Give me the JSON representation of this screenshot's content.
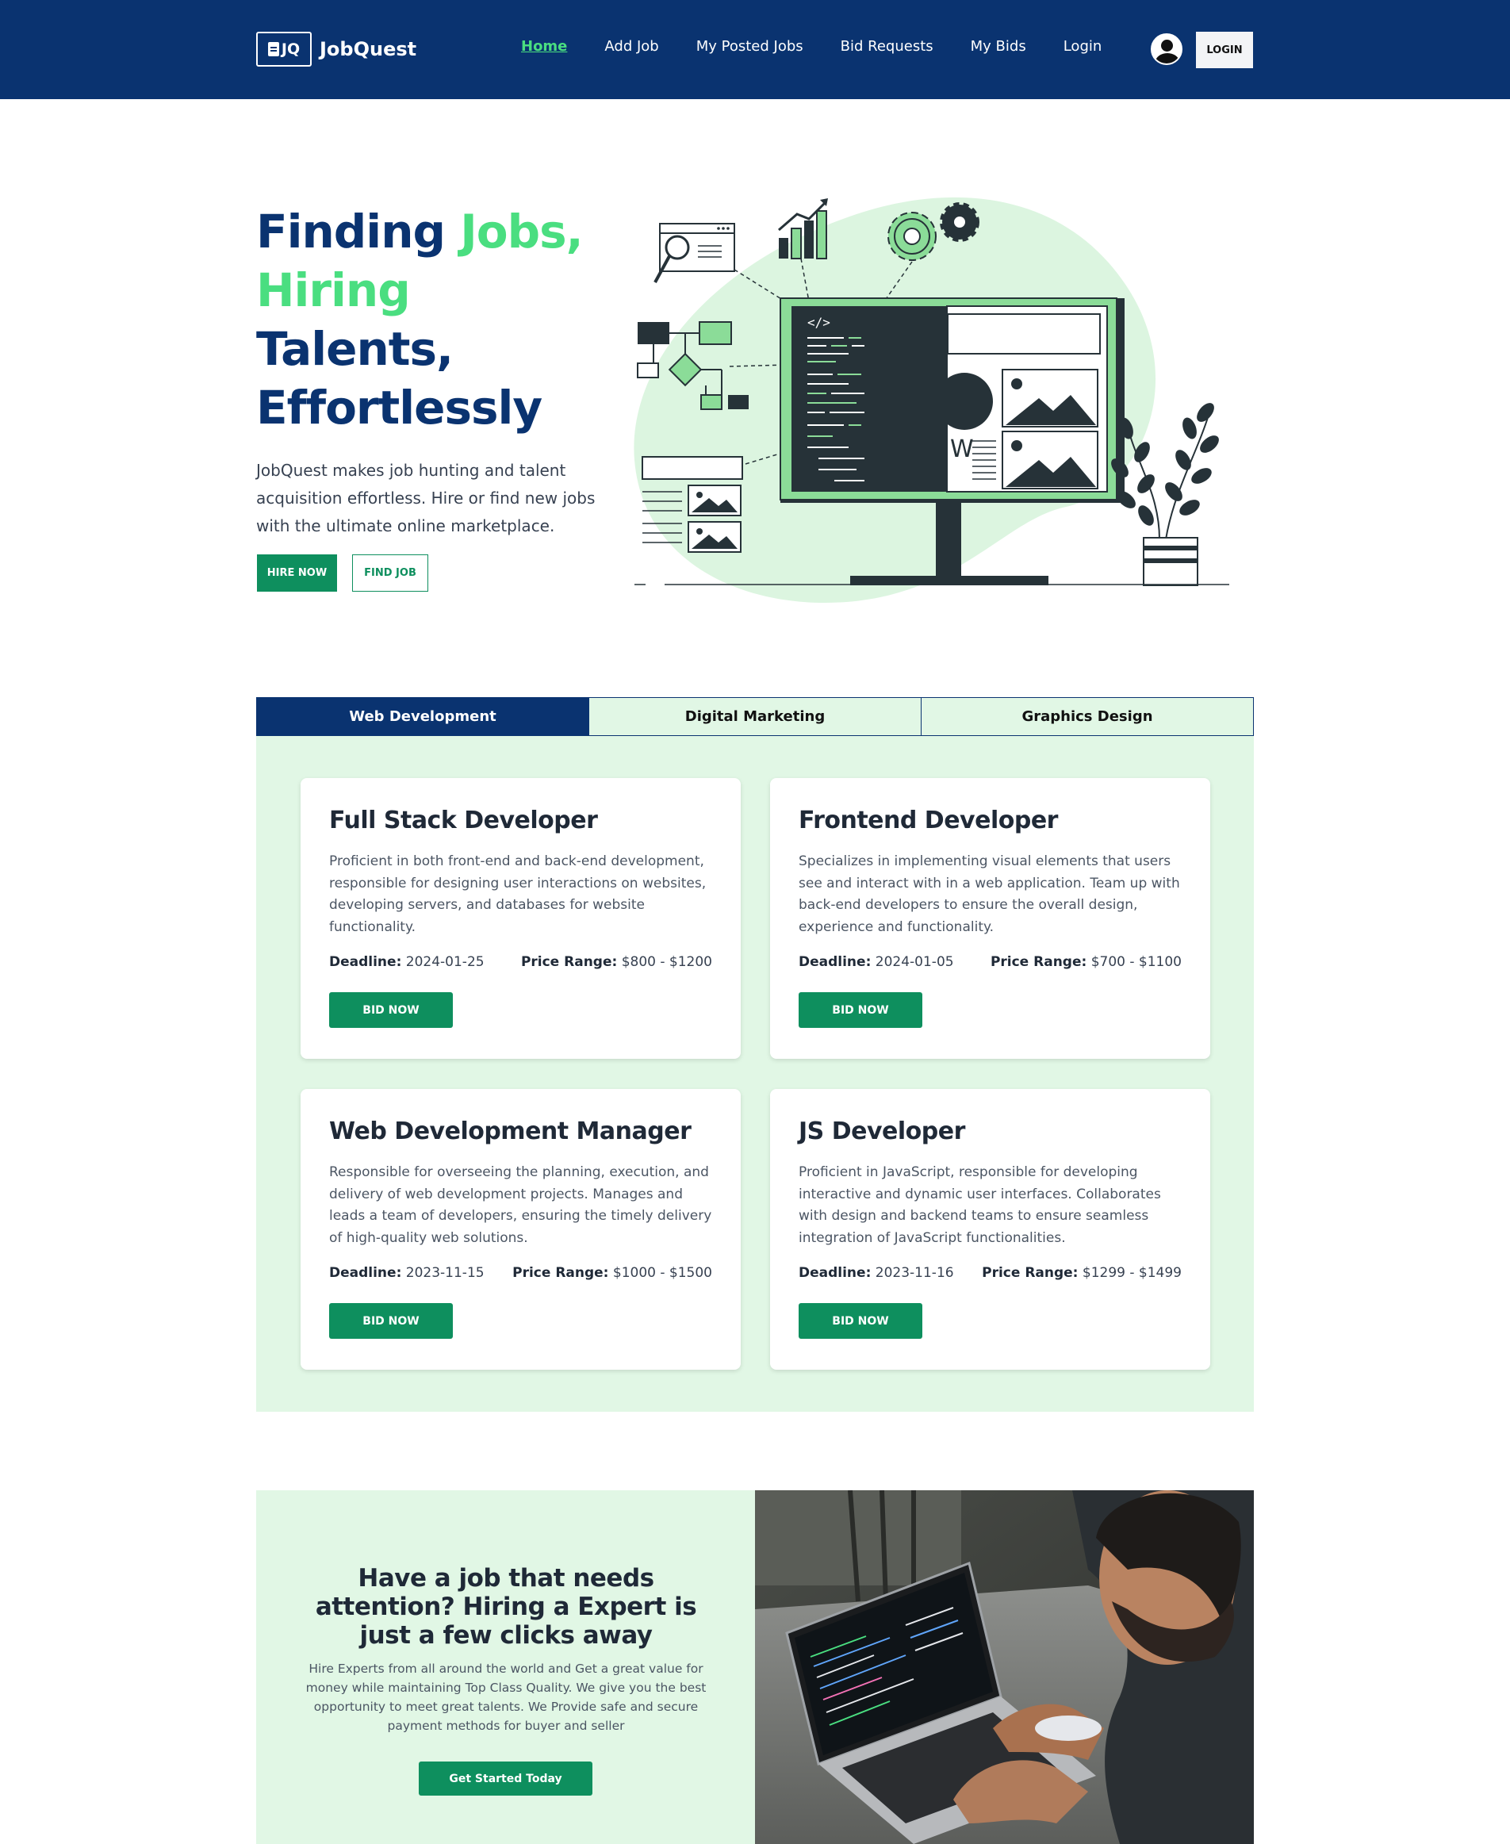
{
  "nav": {
    "brand_mark": "JQ",
    "brand": "JobQuest",
    "links": [
      "Home",
      "Add Job",
      "My Posted Jobs",
      "Bid Requests",
      "My Bids",
      "Login"
    ],
    "active": "Home",
    "login_button": "LOGIN"
  },
  "hero": {
    "title_part1": "Finding ",
    "title_part2": "Jobs,",
    "title_part3": "Hiring",
    "title_part4": "Talents,",
    "title_part5": "Effortlessly",
    "description": "JobQuest makes job hunting and talent acquisition effortless. Hire or find new jobs with the ultimate online marketplace.",
    "hire_button": "HIRE NOW",
    "find_button": "FIND JOB"
  },
  "tabs": {
    "items": [
      "Web Development",
      "Digital Marketing",
      "Graphics Design"
    ],
    "active": "Web Development"
  },
  "jobs": [
    {
      "title": "Full Stack Developer",
      "description": "Proficient in both front-end and back-end development, responsible for designing user interactions on websites, developing servers, and databases for website functionality.",
      "deadline_label": "Deadline:",
      "deadline": "2024-01-25",
      "price_label": "Price Range:",
      "price": "$800 - $1200",
      "button": "BID NOW"
    },
    {
      "title": "Frontend Developer",
      "description": "Specializes in implementing visual elements that users see and interact with in a web application. Team up with back-end developers to ensure the overall design, experience and functionality.",
      "deadline_label": "Deadline:",
      "deadline": "2024-01-05",
      "price_label": "Price Range:",
      "price": "$700 - $1100",
      "button": "BID NOW"
    },
    {
      "title": "Web Development Manager",
      "description": "Responsible for overseeing the planning, execution, and delivery of web development projects. Manages and leads a team of developers, ensuring the timely delivery of high-quality web solutions.",
      "deadline_label": "Deadline:",
      "deadline": "2023-11-15",
      "price_label": "Price Range:",
      "price": "$1000 - $1500",
      "button": "BID NOW"
    },
    {
      "title": "JS Developer",
      "description": "Proficient in JavaScript, responsible for developing interactive and dynamic user interfaces. Collaborates with design and backend teams to ensure seamless integration of JavaScript functionalities.",
      "deadline_label": "Deadline:",
      "deadline": "2023-11-16",
      "price_label": "Price Range:",
      "price": "$1299 - $1499",
      "button": "BID NOW"
    }
  ],
  "cta": {
    "heading": "Have a job that needs attention? Hiring a Expert is just a few clicks away",
    "description": "Hire Experts from all around the world and Get a great value for money while maintaining Top Class Quality. We give you the best opportunity to meet great talents. We Provide safe and secure payment methods for buyer and seller",
    "button": "Get Started Today"
  },
  "colors": {
    "navy": "#0a3370",
    "green_accent": "#4ade80",
    "button_green": "#0e8f5e",
    "mint_bg": "#e1f7e5"
  },
  "icons": [
    "user-avatar-icon",
    "magnifier-icon",
    "bar-chart-icon",
    "gear-icon",
    "monitor-illustration",
    "plant-icon"
  ]
}
